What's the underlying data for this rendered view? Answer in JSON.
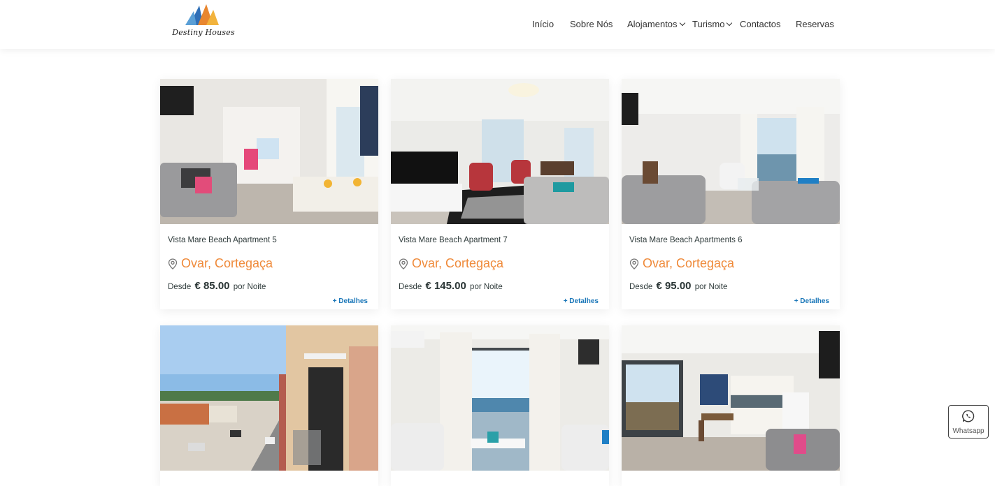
{
  "header": {
    "logo_text": "Destiny Houses",
    "nav": [
      {
        "label": "Início",
        "has_dropdown": false
      },
      {
        "label": "Sobre Nós",
        "has_dropdown": false
      },
      {
        "label": "Alojamentos",
        "has_dropdown": true
      },
      {
        "label": "Turismo",
        "has_dropdown": true
      },
      {
        "label": "Contactos",
        "has_dropdown": false
      },
      {
        "label": "Reservas",
        "has_dropdown": false
      }
    ]
  },
  "listings": [
    {
      "title": "Vista Mare Beach Apartment 5",
      "location": "Ovar, Cortegaça",
      "price_prefix": "Desde",
      "price": "€ 85.00",
      "price_suffix": "por Noite",
      "details_label": "+ Detalhes",
      "photo": "living-room-kitchen-icon"
    },
    {
      "title": "Vista Mare Beach Apartment 7",
      "location": "Ovar, Cortegaça",
      "price_prefix": "Desde",
      "price": "€ 145.00",
      "price_suffix": "por Noite",
      "details_label": "+ Detalhes",
      "photo": "living-room-tv-icon"
    },
    {
      "title": "Vista Mare Beach Apartments 6",
      "location": "Ovar, Cortegaça",
      "price_prefix": "Desde",
      "price": "€ 95.00",
      "price_suffix": "por Noite",
      "details_label": "+ Detalhes",
      "photo": "living-room-sea-view-icon"
    }
  ],
  "photos_row2": [
    "street-balcony-view-icon",
    "balcony-sea-view-icon",
    "kitchen-living-room-icon"
  ],
  "whatsapp": {
    "label": "Whatsapp"
  },
  "colors": {
    "accent": "#ef8a3a",
    "link": "#1976b8",
    "text": "#2f3b3b"
  }
}
